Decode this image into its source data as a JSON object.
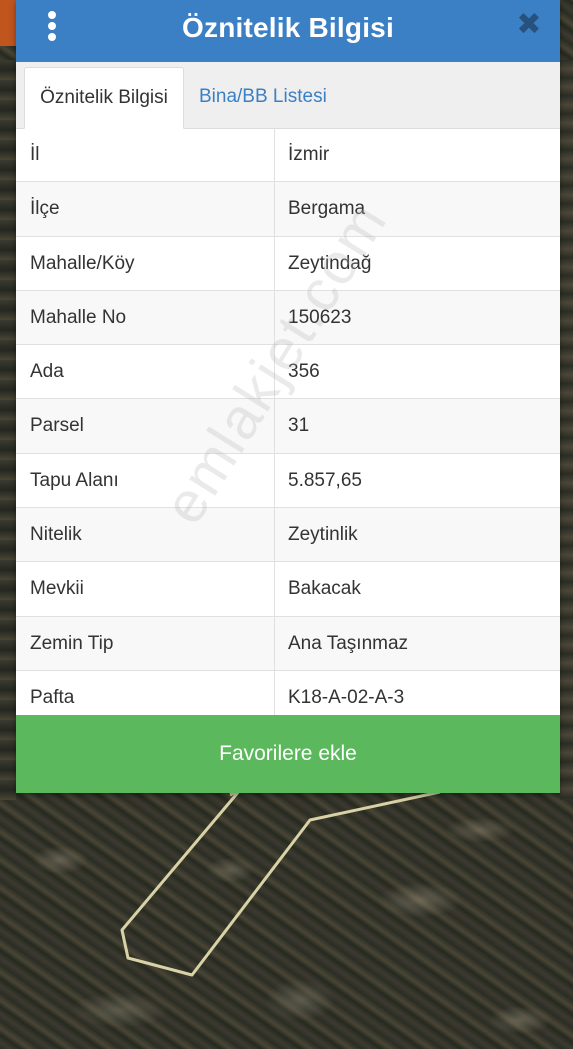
{
  "header": {
    "title": "Öznitelik Bilgisi",
    "close_glyph": "✖"
  },
  "tabs": [
    {
      "label": "Öznitelik Bilgisi",
      "active": true
    },
    {
      "label": "Bina/BB Listesi",
      "active": false
    }
  ],
  "attributes": [
    {
      "key": "İl",
      "value": "İzmir"
    },
    {
      "key": "İlçe",
      "value": "Bergama"
    },
    {
      "key": "Mahalle/Köy",
      "value": "Zeytindağ"
    },
    {
      "key": "Mahalle No",
      "value": "150623"
    },
    {
      "key": "Ada",
      "value": "356"
    },
    {
      "key": "Parsel",
      "value": "31"
    },
    {
      "key": "Tapu Alanı",
      "value": "5.857,65"
    },
    {
      "key": "Nitelik",
      "value": "Zeytinlik"
    },
    {
      "key": "Mevkii",
      "value": "Bakacak"
    },
    {
      "key": "Zemin Tip",
      "value": "Ana Taşınmaz"
    },
    {
      "key": "Pafta",
      "value": "K18-A-02-A-3"
    }
  ],
  "favorite_button": {
    "label": "Favorilere ekle"
  },
  "watermark": "emlakjet.com",
  "colors": {
    "header": "#3b7fc4",
    "tab_link": "#3b7fc4",
    "button": "#5cb85c",
    "parcel_outline": "#d9d2a6"
  },
  "icons": {
    "menu": "vertical-dots-icon",
    "close": "close-icon"
  }
}
